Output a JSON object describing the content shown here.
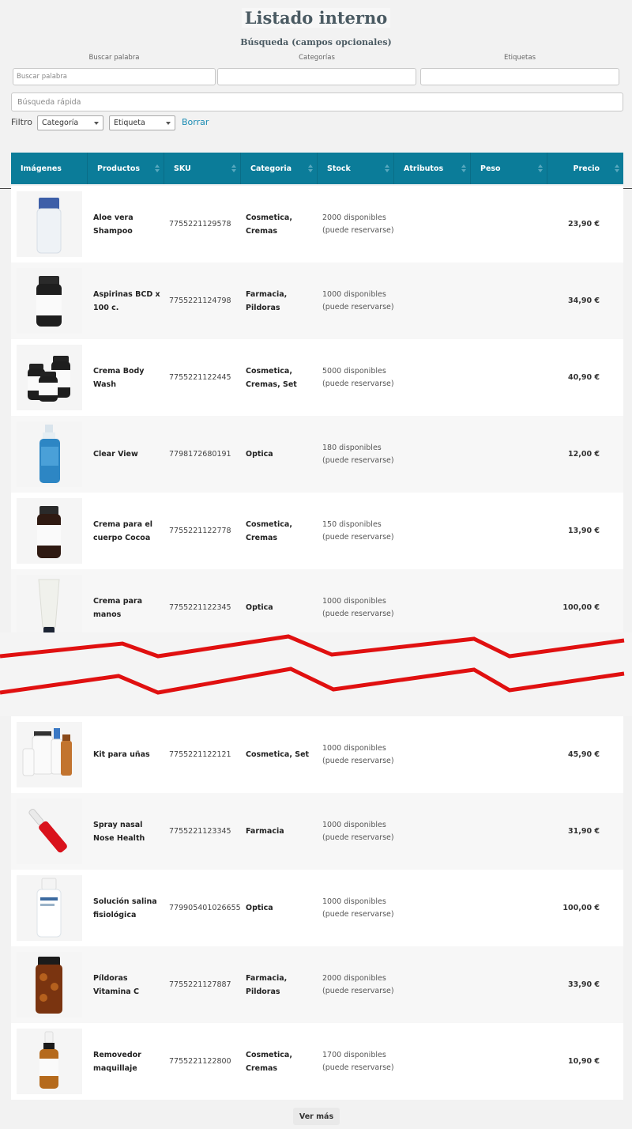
{
  "header": {
    "title": "Listado interno",
    "search_title": "Búsqueda (campos opcionales)"
  },
  "filters": {
    "word_label": "Buscar palabra",
    "word_placeholder": "Buscar palabra",
    "categories_label": "Categorías",
    "tags_label": "Etiquetas",
    "quick_search_placeholder": "Búsqueda rápida",
    "filter_label": "Filtro",
    "category_select": "Categoría",
    "tag_select": "Etiqueta",
    "clear_link": "Borrar"
  },
  "table": {
    "columns": [
      "Imágenes",
      "Productos",
      "SKU",
      "Categoria",
      "Stock",
      "Atributos",
      "Peso",
      "Precio"
    ],
    "rows": [
      {
        "product": "Aloe vera Shampoo",
        "sku": "7755221129578",
        "category": "Cosmetica, Cremas",
        "stock": "2000 disponibles (puede reservarse)",
        "price": "23,90 €",
        "image": "shampoo-bottle"
      },
      {
        "product": "Aspirinas BCD x 100 c.",
        "sku": "7755221124798",
        "category": "Farmacia, Pildoras",
        "stock": "1000 disponibles (puede reservarse)",
        "price": "34,90 €",
        "image": "pill-jar"
      },
      {
        "product": "Crema Body Wash",
        "sku": "7755221122445",
        "category": "Cosmetica, Cremas, Set",
        "stock": "5000 disponibles (puede reservarse)",
        "price": "40,90 €",
        "image": "jar-set"
      },
      {
        "product": "Clear View",
        "sku": "7798172680191",
        "category": "Optica",
        "stock": "180 disponibles (puede reservarse)",
        "price": "12,00 €",
        "image": "spray-bottle-blue"
      },
      {
        "product": "Crema para el cuerpo Cocoa",
        "sku": "7755221122778",
        "category": "Cosmetica, Cremas",
        "stock": "150 disponibles (puede reservarse)",
        "price": "13,90 €",
        "image": "brown-jar"
      },
      {
        "product": "Crema para manos",
        "sku": "7755221122345",
        "category": "Optica",
        "stock": "1000 disponibles (puede reservarse)",
        "price": "100,00 €",
        "image": "cream-tube"
      },
      {
        "product": "Kit para uñas",
        "sku": "7755221122121",
        "category": "Cosmetica, Set",
        "stock": "1000 disponibles (puede reservarse)",
        "price": "45,90 €",
        "image": "nail-kit"
      },
      {
        "product": "Spray nasal Nose Health",
        "sku": "7755221123345",
        "category": "Farmacia",
        "stock": "1000 disponibles (puede reservarse)",
        "price": "31,90 €",
        "image": "red-ampoule"
      },
      {
        "product": "Solución salina fisiológica",
        "sku": "7799054010266​55",
        "category": "Optica",
        "stock": "1000 disponibles (puede reservarse)",
        "price": "100,00 €",
        "image": "saline-bottle"
      },
      {
        "product": "Píldoras Vitamina C",
        "sku": "7755221127887",
        "category": "Farmacia, Pildoras",
        "stock": "2000 disponibles (puede reservarse)",
        "price": "33,90 €",
        "image": "amber-pill-bottle"
      },
      {
        "product": "Removedor maquillaje",
        "sku": "7755221122800",
        "category": "Cosmetica, Cremas",
        "stock": "1700 disponibles (puede reservarse)",
        "price": "10,90 €",
        "image": "amber-dropper-bottle"
      }
    ]
  },
  "footer": {
    "load_more": "Ver más"
  },
  "colors": {
    "header_bg": "#0b7c99",
    "link": "#1a8bb3",
    "break_line": "#e01010"
  }
}
